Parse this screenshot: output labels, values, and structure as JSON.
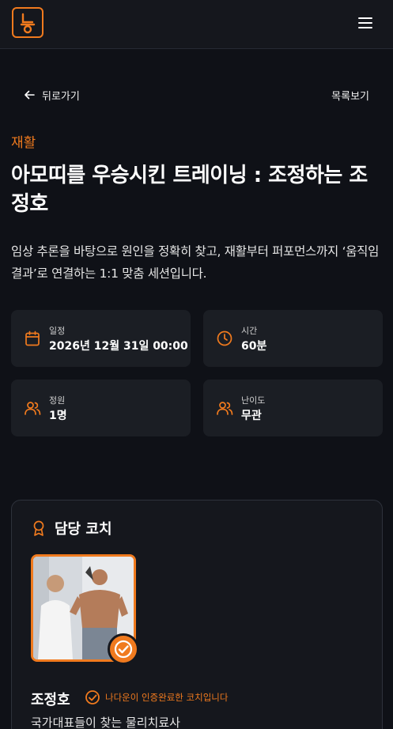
{
  "header": {
    "logo_icon": "brand-logo-icon",
    "menu_icon": "hamburger-menu-icon"
  },
  "nav": {
    "back_label": "뒤로가기",
    "list_label": "목록보기"
  },
  "program": {
    "category": "재활",
    "title": "아모띠를 우승시킨 트레이닝 : 조정하는 조정호",
    "description": "임상 추론을 바탕으로 원인을 정확히 찾고, 재활부터 퍼포먼스까지 ‘움직임 결과’로 연결하는 1:1 맞춤 세션입니다."
  },
  "info": {
    "schedule": {
      "label": "일정",
      "value": "2026년 12월 31일 00:00",
      "icon": "calendar-icon"
    },
    "duration": {
      "label": "시간",
      "value": "60분",
      "icon": "clock-icon"
    },
    "capacity": {
      "label": "정원",
      "value": "1명",
      "icon": "users-icon"
    },
    "difficulty": {
      "label": "난이도",
      "value": "무관",
      "icon": "users-icon"
    }
  },
  "coach": {
    "section_title": "담당 코치",
    "section_icon": "award-icon",
    "name": "조정호",
    "verified_text": "나다운이 인증완료한 코치입니다",
    "verified_icon": "verified-check-icon",
    "subtitle": "국가대표들이 찾는 물리치료사"
  },
  "colors": {
    "accent": "#f07a1e",
    "background": "#0f1117",
    "card": "#1b1e24"
  }
}
